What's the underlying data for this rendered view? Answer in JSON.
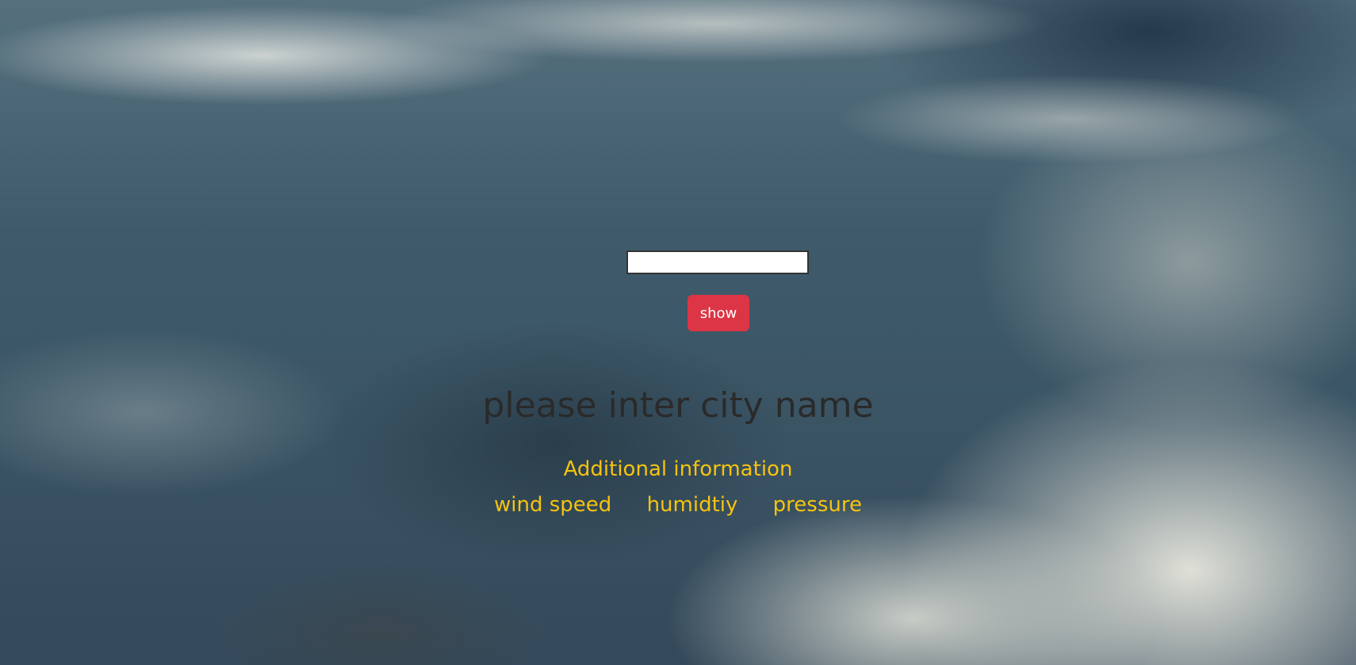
{
  "search": {
    "value": "",
    "placeholder": ""
  },
  "buttons": {
    "show_label": "show"
  },
  "main": {
    "city_heading": "please inter city name",
    "additional_heading": "Additional information",
    "info_items": {
      "wind": "wind speed",
      "humidity": "humidtiy",
      "pressure": "pressure"
    }
  },
  "colors": {
    "button": "#dc3545",
    "info_text": "#f5c30f",
    "heading_text": "#2a2a2a"
  }
}
